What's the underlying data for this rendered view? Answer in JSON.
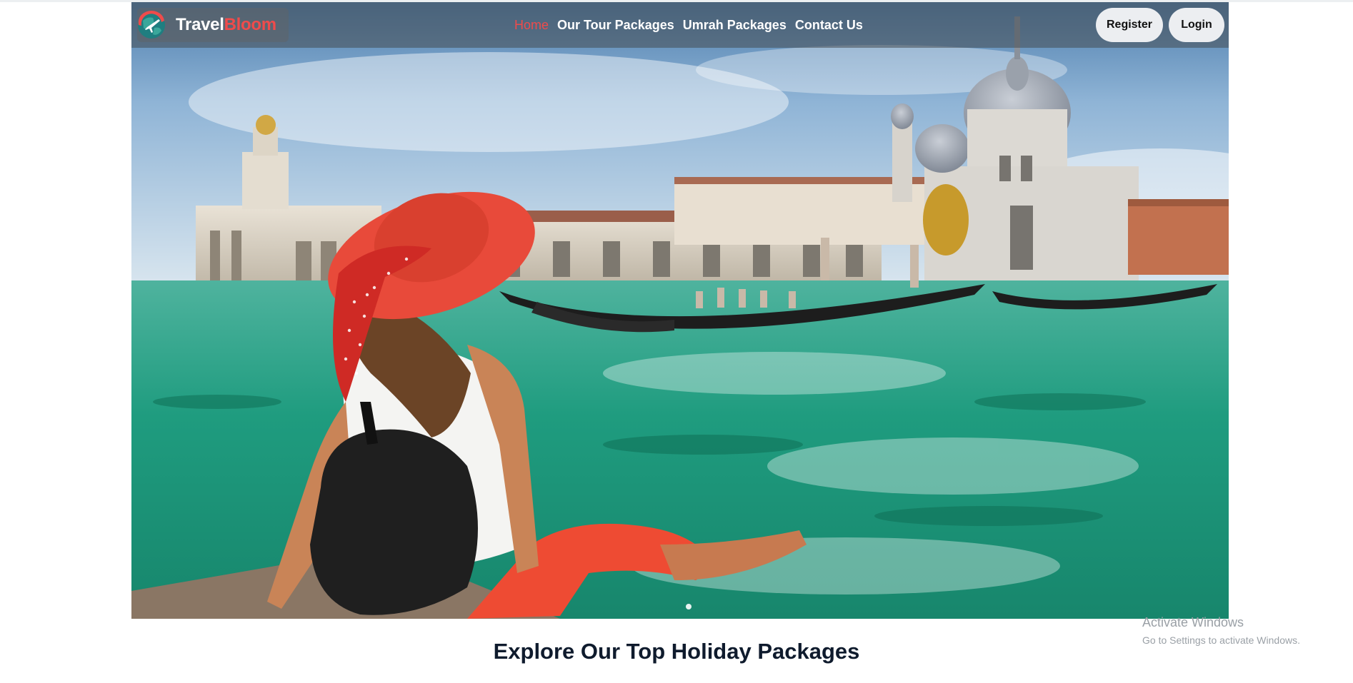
{
  "brand": {
    "name_part1": "Travel",
    "name_part2": "Bloom",
    "logo_icon": "globe-plane-icon",
    "accent_color": "#ef4b4b"
  },
  "nav": {
    "links": [
      {
        "label": "Home",
        "active": true
      },
      {
        "label": "Our Tour Packages",
        "active": false
      },
      {
        "label": "Umrah Packages",
        "active": false
      },
      {
        "label": "Contact Us",
        "active": false
      }
    ]
  },
  "auth": {
    "register_label": "Register",
    "login_label": "Login"
  },
  "hero": {
    "image_subject": "venice-grand-canal-woman-red-hat",
    "carousel_active_index": 0
  },
  "main": {
    "section_title": "Explore Our Top Holiday Packages"
  },
  "os_watermark": {
    "line1": "Activate Windows",
    "line2": "Go to Settings to activate Windows."
  }
}
